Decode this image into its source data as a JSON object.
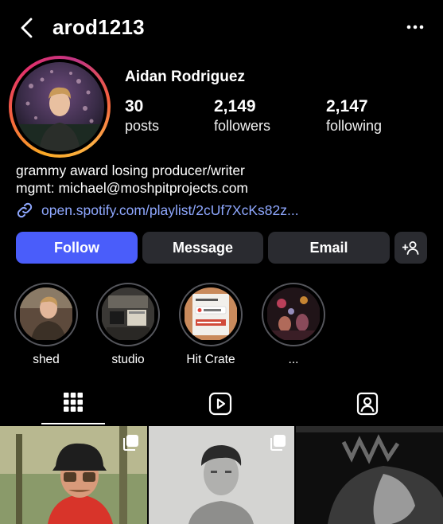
{
  "header": {
    "username": "arod1213",
    "back_icon": "chevron-left-icon",
    "more_icon": "more-horizontal-icon"
  },
  "profile": {
    "full_name": "Aidan Rodriguez",
    "stats": [
      {
        "value": "30",
        "label": "posts"
      },
      {
        "value": "2,149",
        "label": "followers"
      },
      {
        "value": "2,147",
        "label": "following"
      }
    ],
    "bio_lines": [
      "grammy award losing producer/writer",
      "mgmt: michael@moshpitprojects.com"
    ],
    "link": "open.spotify.com/playlist/2cUf7XcKs82z...",
    "story_ring_colors": [
      "#f9a825",
      "#f56040",
      "#e1306c",
      "#c13584"
    ]
  },
  "actions": {
    "follow": "Follow",
    "message": "Message",
    "email": "Email",
    "follow_color": "#4a5dfa",
    "secondary_color": "#2a2b30"
  },
  "highlights": [
    {
      "label": "shed"
    },
    {
      "label": "studio"
    },
    {
      "label": "Hit Crate"
    },
    {
      "label": "..."
    }
  ],
  "tabs": [
    {
      "name": "posts-grid",
      "icon": "grid-icon",
      "active": true
    },
    {
      "name": "reels",
      "icon": "reels-icon",
      "active": false
    },
    {
      "name": "tagged",
      "icon": "tagged-person-icon",
      "active": false
    }
  ]
}
